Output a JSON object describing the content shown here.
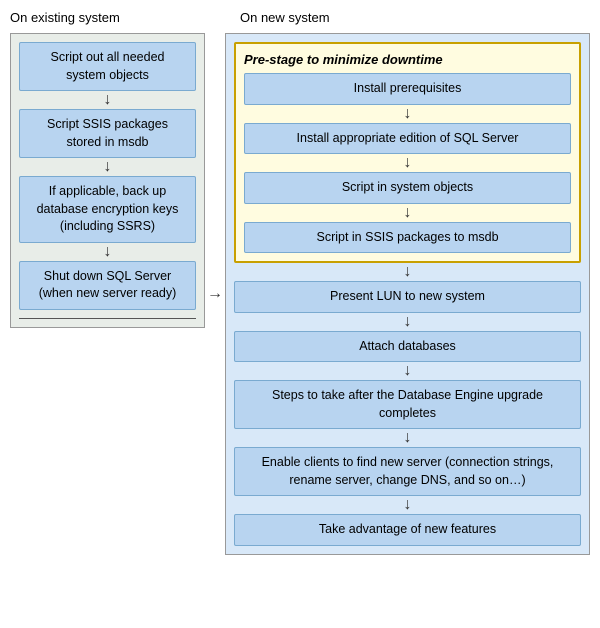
{
  "titles": {
    "left": "On existing system",
    "right": "On new system"
  },
  "left_steps": [
    "Script out all needed system objects",
    "Script SSIS packages stored in msdb",
    "If applicable, back up database encryption keys (including SSRS)",
    "Shut down SQL Server (when new server ready)"
  ],
  "prestage": {
    "label": "Pre-stage to minimize downtime",
    "steps": [
      "Install prerequisites",
      "Install appropriate edition of SQL Server",
      "Script in system objects",
      "Script in SSIS packages to msdb"
    ]
  },
  "right_steps": [
    "Present LUN to new system",
    "Attach databases",
    "Steps to take after the Database Engine upgrade completes",
    "Enable clients to find new server (connection strings, rename server, change DNS, and so on…)",
    "Take advantage of new features"
  ],
  "arrow_symbol": "↓",
  "arrow_right_symbol": "→"
}
